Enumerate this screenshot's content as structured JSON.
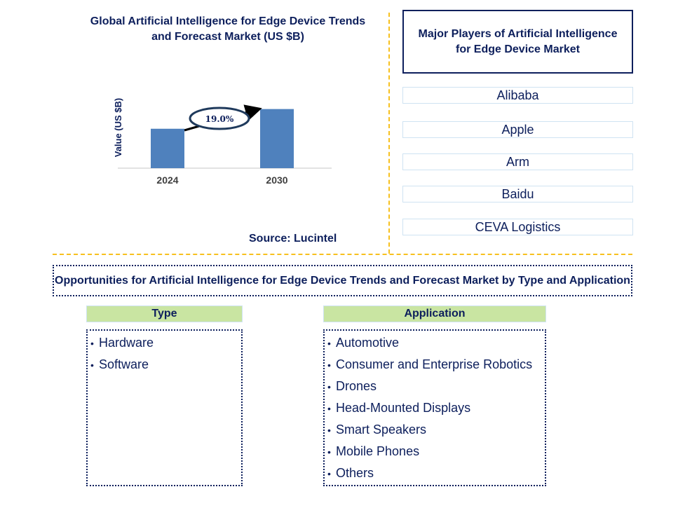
{
  "chart": {
    "title": "Global Artificial Intelligence for Edge Device Trends and Forecast Market (US $B)",
    "source": "Source: Lucintel"
  },
  "chart_data": {
    "type": "bar",
    "title": "Global Artificial Intelligence for Edge Device Trends and Forecast Market (US $B)",
    "categories": [
      "2024",
      "2030"
    ],
    "values": [
      1.0,
      1.5
    ],
    "value_note": "relative bar heights; no numeric axis shown",
    "xlabel": "",
    "ylabel": "Value (US $B)",
    "annotation": "19.0%",
    "annotation_meaning": "CAGR 2024-2030",
    "bar_color": "#4f81bd",
    "grid": false,
    "ylim": [
      0,
      1.6
    ]
  },
  "players": {
    "header": "Major Players of Artificial Intelligence for Edge Device  Market",
    "items": [
      "Alibaba",
      "Apple",
      "Arm",
      "Baidu",
      "CEVA Logistics"
    ]
  },
  "opportunities": {
    "header": "Opportunities for Artificial Intelligence for Edge Device Trends and Forecast Market by Type and Application",
    "bullet": "•",
    "type": {
      "label": "Type",
      "items": [
        "Hardware",
        "Software"
      ]
    },
    "application": {
      "label": "Application",
      "items": [
        "Automotive",
        "Consumer and Enterprise Robotics",
        "Drones",
        "Head-Mounted Displays",
        "Smart Speakers",
        "Mobile Phones",
        "Others"
      ]
    }
  },
  "colors": {
    "navy": "#0d1f5c",
    "bar": "#4f81bd",
    "divider": "#f7c01e",
    "category_header": "#c9e5a2",
    "player_border": "#cfe3f2"
  }
}
